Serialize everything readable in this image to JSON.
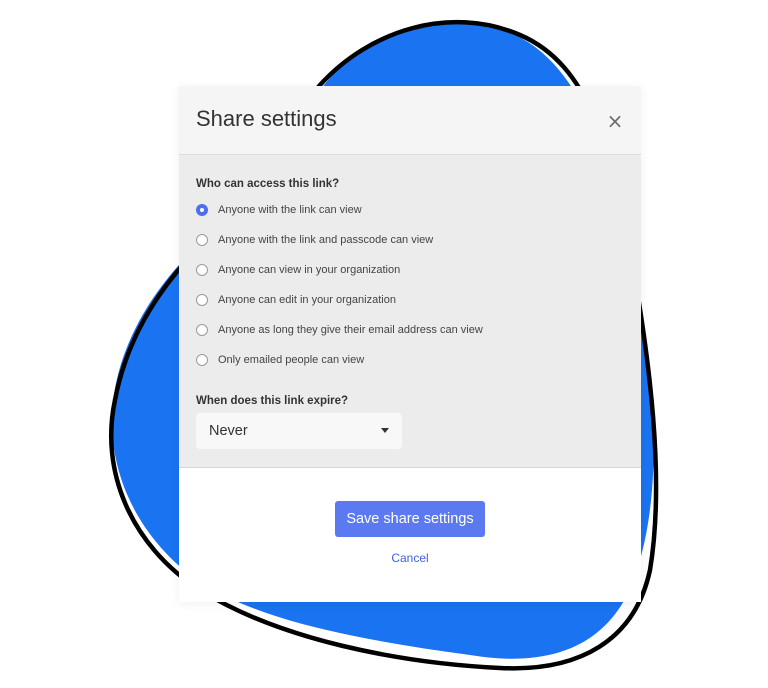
{
  "dialog": {
    "title": "Share settings",
    "close_symbol": "×",
    "access_question": "Who can access this link?",
    "access_options": [
      {
        "label": "Anyone with the link can view",
        "selected": true
      },
      {
        "label": "Anyone with the link and passcode can view",
        "selected": false
      },
      {
        "label": "Anyone can view in your organization",
        "selected": false
      },
      {
        "label": "Anyone can edit in your organization",
        "selected": false
      },
      {
        "label": "Anyone as long they give their email address can view",
        "selected": false
      },
      {
        "label": "Only emailed people can view",
        "selected": false
      }
    ],
    "expire_question": "When does this link expire?",
    "expire_select": {
      "value": "Never",
      "icon": "caret-down-icon"
    },
    "save_label": "Save share settings",
    "cancel_label": "Cancel"
  },
  "colors": {
    "accent": "#5b7af2",
    "link": "#3d63e0",
    "blob_fill": "#1a73f0",
    "blob_outline": "#000000"
  }
}
